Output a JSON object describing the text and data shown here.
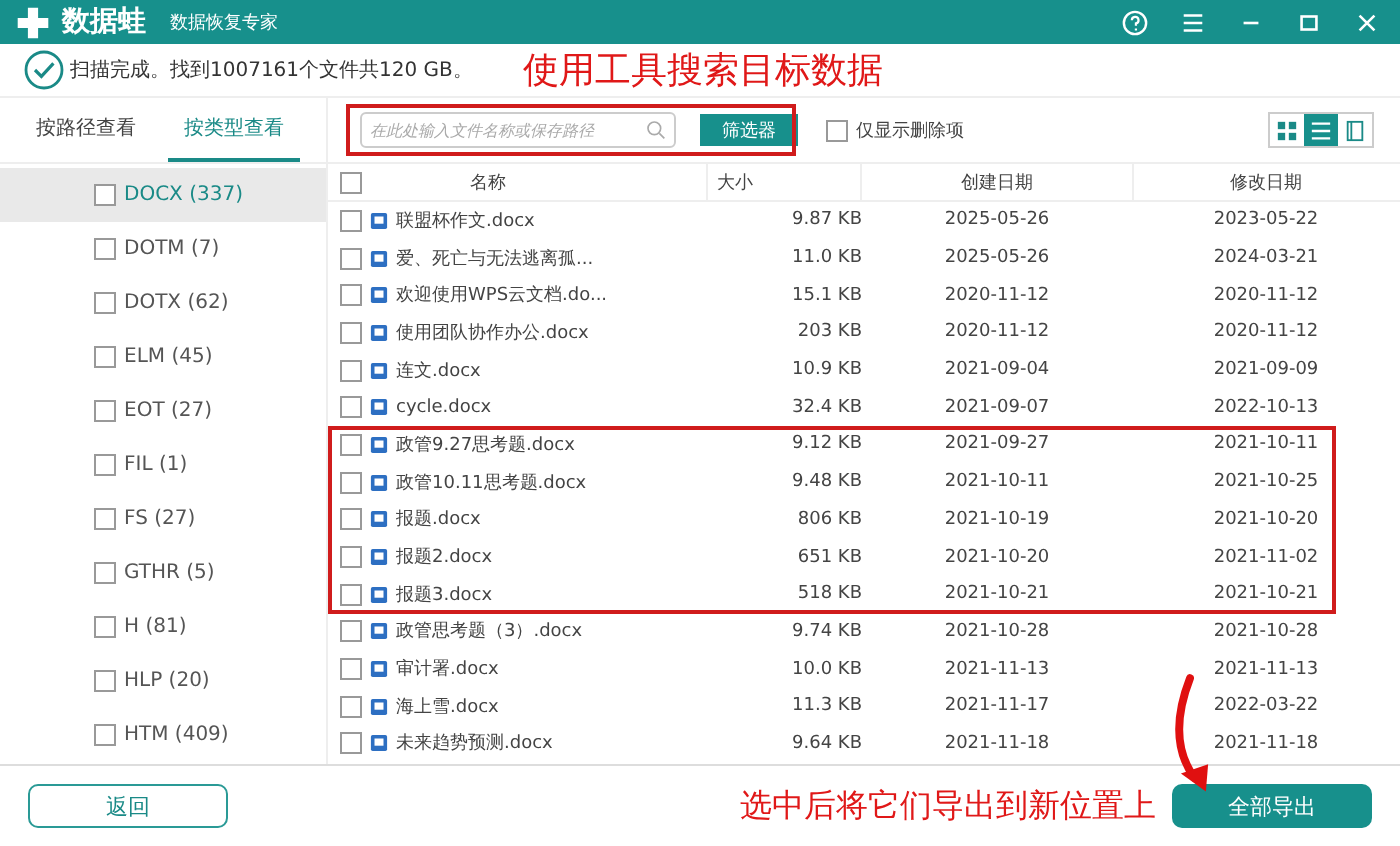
{
  "app": {
    "name": "数据蛙",
    "subtitle": "数据恢复专家"
  },
  "status": "扫描完成。找到1007161个文件共120 GB。",
  "annotation_top": "使用工具搜索目标数据",
  "annotation_bottom": "选中后将它们导出到新位置上",
  "side_tabs": [
    {
      "label": "按路径查看",
      "selected": false
    },
    {
      "label": "按类型查看",
      "selected": true
    }
  ],
  "types": [
    {
      "label": "DOCX (337)",
      "selected": true,
      "checked": false
    },
    {
      "label": "DOTM (7)",
      "selected": false,
      "checked": false
    },
    {
      "label": "DOTX (62)",
      "selected": false,
      "checked": false
    },
    {
      "label": "ELM (45)",
      "selected": false,
      "checked": false
    },
    {
      "label": "EOT (27)",
      "selected": false,
      "checked": false
    },
    {
      "label": "FIL (1)",
      "selected": false,
      "checked": false
    },
    {
      "label": "FS (27)",
      "selected": false,
      "checked": false
    },
    {
      "label": "GTHR (5)",
      "selected": false,
      "checked": false
    },
    {
      "label": "H (81)",
      "selected": false,
      "checked": false
    },
    {
      "label": "HLP (20)",
      "selected": false,
      "checked": false
    },
    {
      "label": "HTM (409)",
      "selected": false,
      "checked": false
    }
  ],
  "search": {
    "placeholder": "在此处输入文件名称或保存路径"
  },
  "filter_button": "筛选器",
  "deleted_only": {
    "label": "仅显示删除项",
    "checked": false
  },
  "views": [
    {
      "kind": "grid",
      "selected": false
    },
    {
      "kind": "list",
      "selected": true
    },
    {
      "kind": "preview",
      "selected": false
    }
  ],
  "columns": [
    "名称",
    "大小",
    "创建日期",
    "修改日期"
  ],
  "all_checked": false,
  "rows": [
    {
      "name": "联盟杯作文.docx",
      "size": "9.87 KB",
      "created": "2025-05-26",
      "modified": "2023-05-22",
      "highlighted": false,
      "checked": false
    },
    {
      "name": "爱、死亡与无法逃离孤...",
      "size": "11.0 KB",
      "created": "2025-05-26",
      "modified": "2024-03-21",
      "highlighted": false,
      "checked": false
    },
    {
      "name": "欢迎使用WPS云文档.do...",
      "size": "15.1 KB",
      "created": "2020-11-12",
      "modified": "2020-11-12",
      "highlighted": false,
      "checked": false
    },
    {
      "name": "使用团队协作办公.docx",
      "size": "203 KB",
      "created": "2020-11-12",
      "modified": "2020-11-12",
      "highlighted": false,
      "checked": false
    },
    {
      "name": "连文.docx",
      "size": "10.9 KB",
      "created": "2021-09-04",
      "modified": "2021-09-09",
      "highlighted": false,
      "checked": false
    },
    {
      "name": "cycle.docx",
      "size": "32.4 KB",
      "created": "2021-09-07",
      "modified": "2022-10-13",
      "highlighted": false,
      "checked": false
    },
    {
      "name": "政管9.27思考题.docx",
      "size": "9.12 KB",
      "created": "2021-09-27",
      "modified": "2021-10-11",
      "highlighted": true,
      "checked": false
    },
    {
      "name": "政管10.11思考题.docx",
      "size": "9.48 KB",
      "created": "2021-10-11",
      "modified": "2021-10-25",
      "highlighted": true,
      "checked": false
    },
    {
      "name": "报题.docx",
      "size": "806 KB",
      "created": "2021-10-19",
      "modified": "2021-10-20",
      "highlighted": true,
      "checked": false
    },
    {
      "name": "报题2.docx",
      "size": "651 KB",
      "created": "2021-10-20",
      "modified": "2021-11-02",
      "highlighted": true,
      "checked": false
    },
    {
      "name": "报题3.docx",
      "size": "518 KB",
      "created": "2021-10-21",
      "modified": "2021-10-21",
      "highlighted": true,
      "checked": false
    },
    {
      "name": "政管思考题（3）.docx",
      "size": "9.74 KB",
      "created": "2021-10-28",
      "modified": "2021-10-28",
      "highlighted": false,
      "checked": false
    },
    {
      "name": "审计署.docx",
      "size": "10.0 KB",
      "created": "2021-11-13",
      "modified": "2021-11-13",
      "highlighted": false,
      "checked": false
    },
    {
      "name": "海上雪.docx",
      "size": "11.3 KB",
      "created": "2021-11-17",
      "modified": "2022-03-22",
      "highlighted": false,
      "checked": false
    },
    {
      "name": "未来趋势预测.docx",
      "size": "9.64 KB",
      "created": "2021-11-18",
      "modified": "2021-11-18",
      "highlighted": false,
      "checked": false
    }
  ],
  "back_button": "返回",
  "export_button": "全部导出"
}
